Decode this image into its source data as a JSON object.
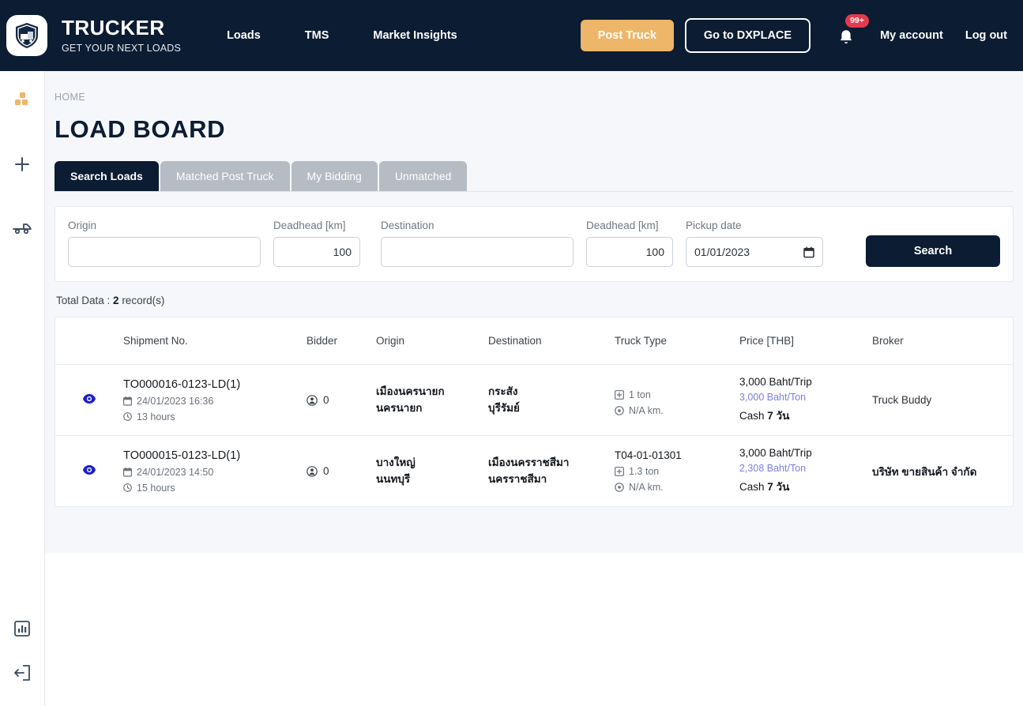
{
  "header": {
    "logo_icon": "truck-shield-logo-icon",
    "brand_title": "TRUCKER",
    "brand_subtitle": "GET YOUR NEXT LOADS",
    "nav": [
      {
        "label": "Loads"
      },
      {
        "label": "TMS"
      },
      {
        "label": "Market Insights"
      }
    ],
    "post_truck_label": "Post Truck",
    "dxplace_label": "Go to DXPLACE",
    "bell_icon": "bell-icon",
    "notification_badge": "99+",
    "my_account_label": "My account",
    "logout_label": "Log out",
    "colors": {
      "bar_bg": "#0b1c33",
      "post_truck_bg": "#eeb668",
      "badge_bg": "#e23b4e"
    }
  },
  "sidebar": {
    "items": [
      {
        "icon": "boxes-icon",
        "active": true
      },
      {
        "icon": "plus-icon",
        "active": false
      },
      {
        "icon": "truck-icon",
        "active": false
      },
      {
        "icon": "chart-bar-icon",
        "active": false
      },
      {
        "icon": "logout-icon",
        "active": false
      }
    ],
    "active_color": "#eeb668",
    "idle_color": "#3c4a5e"
  },
  "page": {
    "breadcrumb": "HOME",
    "title": "LOAD BOARD"
  },
  "tabs": [
    {
      "label": "Search Loads",
      "active": true
    },
    {
      "label": "Matched Post Truck",
      "active": false
    },
    {
      "label": "My Bidding",
      "active": false
    },
    {
      "label": "Unmatched",
      "active": false
    }
  ],
  "search_form": {
    "origin": {
      "label": "Origin",
      "value": "",
      "placeholder": ""
    },
    "deadhead_origin": {
      "label": "Deadhead [km]",
      "value": "100"
    },
    "destination": {
      "label": "Destination",
      "value": "",
      "placeholder": ""
    },
    "deadhead_destination": {
      "label": "Deadhead [km]",
      "value": "100"
    },
    "pickup_date": {
      "label": "Pickup date",
      "value": "01/01/2023",
      "icon": "calendar-icon"
    },
    "search_button": "Search"
  },
  "results": {
    "total_prefix": "Total Data : ",
    "total_count": "2",
    "total_suffix": " record(s)",
    "columns": [
      {
        "key": "eye",
        "label": ""
      },
      {
        "key": "shipment",
        "label": "Shipment No."
      },
      {
        "key": "bidder",
        "label": "Bidder"
      },
      {
        "key": "origin",
        "label": "Origin"
      },
      {
        "key": "destination",
        "label": "Destination"
      },
      {
        "key": "truck_type",
        "label": "Truck Type"
      },
      {
        "key": "price",
        "label": "Price [THB]"
      },
      {
        "key": "broker",
        "label": "Broker"
      }
    ],
    "rows": [
      {
        "view_icon": "eye-icon",
        "shipment_no": "TO000016-0123-LD(1)",
        "date_icon": "calendar-icon",
        "date": "24/01/2023 16:36",
        "duration_icon": "clock-icon",
        "duration": "13 hours",
        "bidder_icon": "bidder-user-icon",
        "bidder_count": "0",
        "origin_district": "เมืองนครนายก",
        "origin_province": "นครนายก",
        "destination_district": "กระสัง",
        "destination_province": "บุรีรัมย์",
        "truck_code": "",
        "weight_icon": "box-icon",
        "weight": "1 ton",
        "distance_icon": "target-icon",
        "distance": "N/A km.",
        "price_trip": "3,000 Baht/Trip",
        "price_ton": "3,000 Baht/Ton",
        "price_term_prefix": "Cash ",
        "price_term_value": "7 วัน",
        "broker": "Truck Buddy",
        "broker_bold": false
      },
      {
        "view_icon": "eye-icon",
        "shipment_no": "TO000015-0123-LD(1)",
        "date_icon": "calendar-icon",
        "date": "24/01/2023 14:50",
        "duration_icon": "clock-icon",
        "duration": "15 hours",
        "bidder_icon": "bidder-user-icon",
        "bidder_count": "0",
        "origin_district": "บางใหญ่",
        "origin_province": "นนทบุรี",
        "destination_district": "เมืองนครราชสีมา",
        "destination_province": "นครราชสีมา",
        "truck_code": "T04-01-01301",
        "weight_icon": "box-icon",
        "weight": "1.3 ton",
        "distance_icon": "target-icon",
        "distance": "N/A km.",
        "price_trip": "3,000 Baht/Trip",
        "price_ton": "2,308 Baht/Ton",
        "price_term_prefix": "Cash ",
        "price_term_value": "7 วัน",
        "broker": "บริษัท ขายสินค้า จำกัด",
        "broker_bold": true
      }
    ]
  }
}
